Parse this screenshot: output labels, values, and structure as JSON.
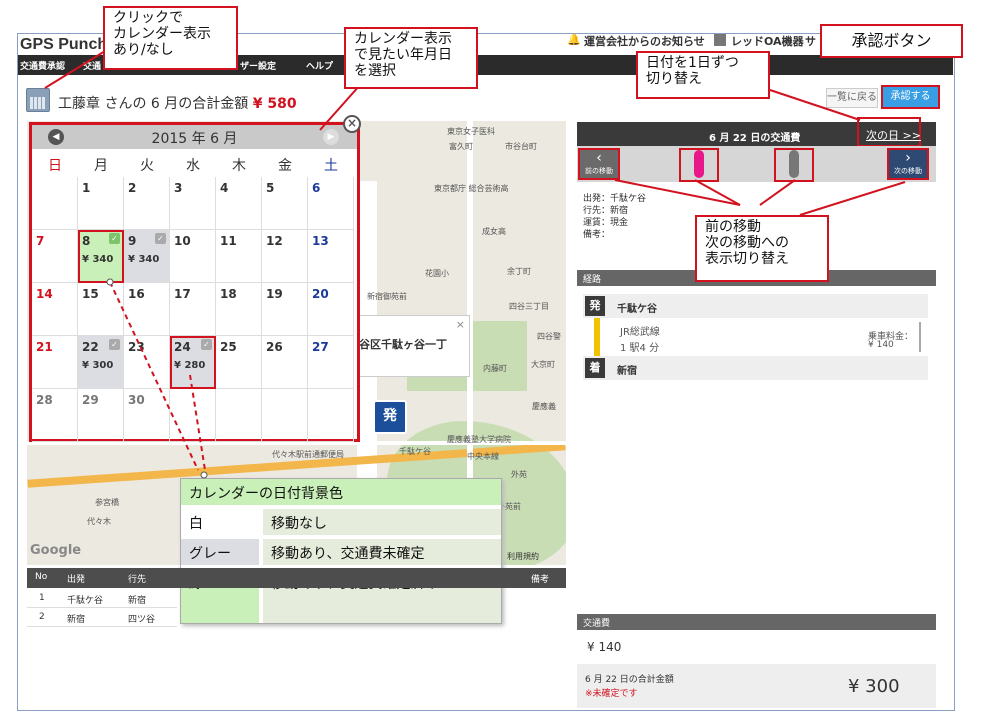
{
  "app": {
    "logo": "GPS Punch!",
    "notice": "運営会社からのお知らせ",
    "company": "レッドOA機器",
    "user": "サ"
  },
  "navbar": [
    "交通費承認",
    "交通",
    "ザー設定",
    "ヘルプ"
  ],
  "title": {
    "prefix": "工藤章 さんの 6 月の合計金額",
    "amount": "¥ 580"
  },
  "buttons": {
    "back": "一覧に戻る",
    "approve": "承認する"
  },
  "calendar": {
    "title": "2015 年 6 月",
    "weekdays": [
      "日",
      "月",
      "火",
      "水",
      "木",
      "金",
      "土"
    ],
    "rows": [
      [
        {
          "d": ""
        },
        {
          "d": "1"
        },
        {
          "d": "2"
        },
        {
          "d": "3"
        },
        {
          "d": "4"
        },
        {
          "d": "5"
        },
        {
          "d": "6"
        }
      ],
      [
        {
          "d": "7"
        },
        {
          "d": "8",
          "yen": "¥ 340",
          "state": "green"
        },
        {
          "d": "9",
          "yen": "¥ 340",
          "state": "gray"
        },
        {
          "d": "10"
        },
        {
          "d": "11"
        },
        {
          "d": "12"
        },
        {
          "d": "13"
        }
      ],
      [
        {
          "d": "14"
        },
        {
          "d": "15"
        },
        {
          "d": "16"
        },
        {
          "d": "17"
        },
        {
          "d": "18"
        },
        {
          "d": "19"
        },
        {
          "d": "20"
        }
      ],
      [
        {
          "d": "21"
        },
        {
          "d": "22",
          "yen": "¥ 300",
          "state": "gray"
        },
        {
          "d": "23"
        },
        {
          "d": "24",
          "yen": "¥ 280",
          "state": "gray"
        },
        {
          "d": "25"
        },
        {
          "d": "26"
        },
        {
          "d": "27"
        }
      ],
      [
        {
          "d": "28"
        },
        {
          "d": "29"
        },
        {
          "d": "30"
        },
        {
          "d": ""
        },
        {
          "d": ""
        },
        {
          "d": ""
        },
        {
          "d": ""
        }
      ]
    ]
  },
  "map": {
    "popup": "谷区千駄ヶ谷一丁",
    "marker": "発",
    "google": "Google",
    "labels": [
      "東京女子医科",
      "富久町",
      "市谷台町",
      "東京都庁 総合芸術高",
      "成女高",
      "余丁町",
      "花園小",
      "新宿御苑前",
      "四谷三丁目",
      "四谷警",
      "大京町",
      "内藤町",
      "慶應義",
      "慶應義塾大学病院",
      "代々木駅前通郵便局",
      "千駄ケ谷",
      "中央本線",
      "参宮橋",
      "代々木",
      "外苑",
      "外苑前",
      "利用規約"
    ]
  },
  "legend": {
    "title": "カレンダーの日付背景色",
    "rows": [
      {
        "k": "白",
        "v": "移動なし"
      },
      {
        "k": "グレー",
        "v": "移動あり、交通費未確定"
      },
      {
        "k": "緑",
        "v": "移動あり、交通費確定済み"
      }
    ]
  },
  "table": {
    "headers": [
      "No",
      "出発",
      "行先",
      "備考"
    ],
    "rows": [
      [
        "1",
        "千駄ケ谷",
        "新宿"
      ],
      [
        "2",
        "新宿",
        "四ツ谷"
      ]
    ]
  },
  "right": {
    "header": "6 月 22 日の交通費",
    "next_day": "次の日 >>",
    "prev_move": "前の移動",
    "next_move": "次の移動",
    "info": [
      "出発：千駄ケ谷",
      "行先：新宿",
      "運賃：現金",
      "備考："
    ],
    "route_label": "経路",
    "from_badge": "発",
    "from": "千駄ケ谷",
    "line": "JR総武線",
    "stops": "1 駅4 分",
    "fare_label": "乗車料金：",
    "fare": "¥ 140",
    "to_badge": "着",
    "to": "新宿",
    "cost_label": "交通費",
    "cost": "¥ 140",
    "total_label": "6 月 22 日の合計金額",
    "unconfirmed": "※未確定です",
    "total": "¥ 300"
  },
  "annotations": {
    "click": "クリックで\nカレンダー表示\nあり/なし",
    "select": "カレンダー表示\nで見たい年月日\nを選択",
    "approve": "承認ボタン",
    "day_switch": "日付を1日ずつ\n切り替え",
    "move_switch": "前の移動\n次の移動への\n表示切り替え"
  },
  "colors": {
    "accent": "#d2121f",
    "approve": "#3a9ee4",
    "green": "#c8f0b8",
    "gray": "#dcdde3",
    "magenta": "#e8178a"
  }
}
